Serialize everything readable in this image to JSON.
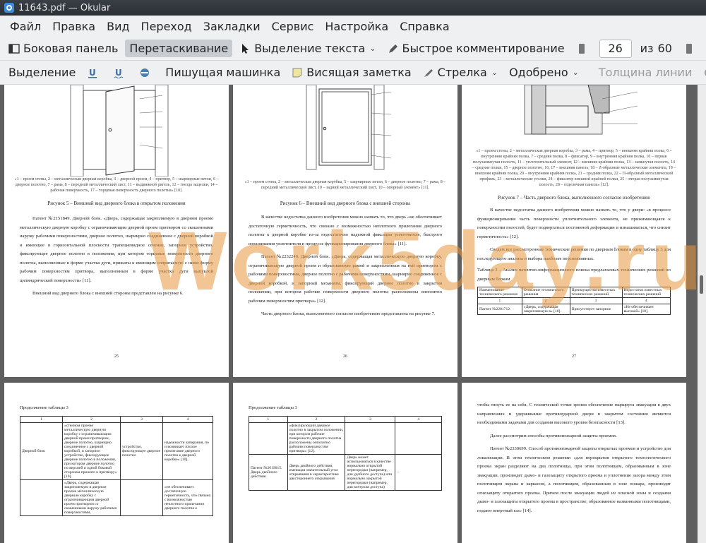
{
  "window": {
    "title": "11643.pdf  — Okular"
  },
  "menu": [
    "Файл",
    "Правка",
    "Вид",
    "Переход",
    "Закладки",
    "Сервис",
    "Настройка",
    "Справка"
  ],
  "toolbar1": {
    "sidebar": "Боковая панель",
    "drag": "Перетаскивание",
    "text_select": "Выделение текста",
    "quick_comment": "Быстрое комментирование",
    "page_current": "26",
    "page_of": "из",
    "page_total": "60"
  },
  "toolbar2": {
    "selection": "Выделение",
    "typewriter": "Пишущая машинка",
    "hanging_note": "Висящая заметка",
    "arrow": "Стрелка",
    "approved": "Одобрено",
    "line_width": "Толщина линии"
  },
  "watermark": "Work5day.ru",
  "pages": {
    "p25": {
      "caption": "«1 – проем стены, 2 – металлическая дверная коробка, 3 – дверной проем, 4 – притвор, 5 – шарнирные петли, 6 – дверное полотно, 7 – рама, 8 – передний металлический лист, 11 – выдвижной ригель, 12 – гнезда защелки, 14 – рабочая поверхность, 17 – торцевая поверхность дверного полотна» [10].",
      "fig_title": "Рисунок 5 – Внешний вид дверного блока в открытом положении",
      "para1": "Патент №2151849. Дверной блок. «Дверь, содержащая закрепляемую в дверном проеме металлическую дверную коробку с ограничивающим дверной проем притвором со скошенными наружу рабочими поверхностями, дверное полотно, шарнирно соединенное с дверной коробкой и имеющее в горизонтальной плоскости трапециевидное сечение, запорное устройство, фиксирующее дверное полотно в положении, при котором торцевые поверхности дверного полотна, выполненные в форме участка дуги, прижаты к имеющим сопрягаемую с ними форму рабочим поверхностям притвора, выполненным в форме участка дуги выпуклой цилиндрической поверхности» [11].",
      "para2": "Внешний вид дверного блока с внешней стороны представлен на рисунке 6.",
      "num": "25"
    },
    "p26": {
      "caption": "«1 – проем стены, 2 – металлическая дверная коробка, 5 – шарнирные петли, 6 – дверное полотно, 7 – рама, 8 – передний металлический лист, 10 – задний металлический лист, 10 – опорный элемент» [11].",
      "fig_title": "Рисунок 6 – Внешний вид дверного блока с внешней стороны",
      "para1": "В качестве недостатка данного изобретения можно назвать то, что дверь «не обеспечивает достаточную герметичность, что связано с возможностью неплотного прилегания дверного полотна к дверной коробке из-за недостаточно надежной фиксации уплотнителя, быстрого изнашивания уплотнителя в процессе функционирования дверного блока» [11].",
      "para2": "Патент №2232240. Дверной блок. «Дверь, содержащая металлическую дверную коробку, ограничивающую дверной проем и образованную рамой и закрепленным на ней притвором с рабочими поверхностями, дверное полотно с рабочими поверхностями, шарнирно соединенное с дверной коробкой, и запорный механизм, фиксирующий дверное полотно в закрытом положении, при котором рабочие поверхности дверного полотна расположены оппозитно рабочим поверхностям притвора» [12].",
      "para3": "Часть дверного блока, выполненного согласно изобретению представлена на рисунке 7.",
      "num": "26"
    },
    "p27": {
      "caption": "«1 – проем стены, 2 – металлическая дверная коробка, 3 – рама, 4 – притвор, 5 – внешняя крайняя полка, 6 – внутренняя крайняя полка, 7 – средняя полка, 8 – фиксатор, 9 – внутренняя крайняя полка, 10 – первая полузамкнутая полость, 11 – уплотнительный элемент, 12 – внешняя крайняя полка, 13 – замкнутая полость, 14 – средние полки, 15 – дверное полотно, 16, 17 – внешняя панель, 18 – Z-образные металлические элементы, 19 – внешняя крайняя полка, 20 – внутренняя крайняя полка, 21 – средняя полка, 22 – П-образный металлический профиль, 23 – металлические уголки, 24 – фиксатор внешней крайней полки, 25 – вторая полузамкнутая полость, 28 – отделочная панель» [12].",
      "fig_title": "Рисунок 7 – Часть дверного блока, выполненного согласно изобретению",
      "para1": "В качестве недостатка данного изобретения можно назвать то, что у двери: «в процессе функционирования часть поверхности уплотнительного элемента, не прижимающаяся к поверхностям полостей, будет подвергаться постоянной деформации и изнашиваться, что снизит герметичность» [12].",
      "para2": "Сведем все рассмотренные технические решения по дверным блокам в одну таблицу 3 для последующего анализа и выбора наиболее перспективных.",
      "table_caption": "Таблица 3 – Анализ патентно-информационного поиска предлагаемых технических решений по дверным блокам",
      "table_head": [
        "Наименование технического решения",
        "Описание технического решения",
        "Преимущества известных технических решений",
        "Недостатки известных технических решений"
      ],
      "table_nums": [
        "1",
        "2",
        "3",
        "4"
      ],
      "table_row": [
        "Патент №2281712.",
        "«Дверь, содержащая закрепляемую в» [10].",
        "Присутствует запорное",
        "«Не обеспечивает высокой» [10]."
      ],
      "num": "27"
    },
    "p28": {
      "caption": "Продолжение таблицы 3",
      "nums": [
        "1",
        "2",
        "3",
        "4"
      ],
      "row1": [
        "Дверной блок",
        "«стенном проеме металлическую дверную коробку с ограничивающим дверной проем притвором, дверное полотно, шарнирно соединенное с дверной коробкой, и запорное устройство, фиксирующее дверное полотно в положении, при котором дверное полотно по верхней и одной боковой сторонам прижато к притвору» [10].",
        "устройство, фиксирующее дверное полотно",
        "надежности запирания, по и возникает плохое прилегание дверного полотна к дверной коробке» [10]."
      ],
      "row2": [
        "",
        "«Дверь, содержащая закрепляемую в дверном проеме металлическую дверную коробку с ограничивающим дверной проем притвором со скошенными наружу рабочими поверхностями,",
        "",
        "«не обеспечивает достаточную герметичность, что связано с возможностью неплотного прилегания дверного полотна к"
      ]
    },
    "p29": {
      "caption": "Продолжение таблицы 3",
      "nums": [
        "1",
        "2",
        "3",
        "4"
      ],
      "row1": [
        "",
        "«фиксирующий дверное полотно в закрытом положении, при котором рабочие поверхности дверного полотна расположены оппозитно рабочим поверхностям притвора» [12].",
        "",
        ""
      ],
      "row2": [
        "Патент №2619015. Дверь двойного действия.",
        "Дверь двойного действия, имеющая значительный угол открывания в характеристике двустороннего открывания",
        "Дверь может использоваться в качестве нормально открытой перегородки (например, для удобного доступа) или нормально закрытой перегородки (например, для контроля доступа)",
        "–"
      ]
    },
    "p30": {
      "para0": "чтобы тянуть ее на себя. С технической точки зрения обеспечение маршрута эвакуации в двух направлениях и удерживание противоударной двери в закрытом состоянии являются необходимыми задачами для создания высокого уровня безопасности [13].",
      "para1": "Далее рассмотрим способы противопожарной защиты проемов.",
      "para2": "Патент №2330699. Способ противопожарной защиты открытых проемов и устройство для локализации. В этом техническом решении «для перекрытия открытого технологического проема экран разделяют на два полотнища, при этом полотнищем, образованным в зоне эвакуации, производят дымо- и газозащиту открытого проема и уплотнение зазора между этим полотнищем экрана и каркасом, а полотнищем, образованным в зоне пожара, производят огнезащиту открытого проема. Причем после эвакуации людей из опасной зоны и создания дымо- и газозащиты открытого проема в пространстве, образованное названными полотнищами, подают инертный газ» [14]."
    }
  }
}
